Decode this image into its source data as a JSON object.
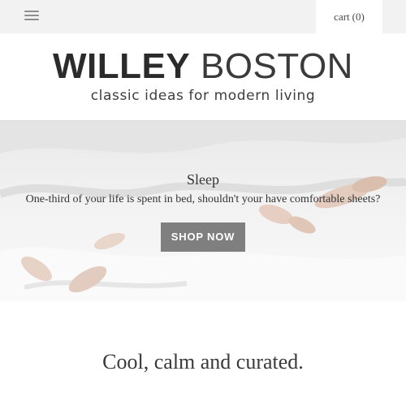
{
  "header": {
    "menu_icon": "hamburger-icon",
    "cart_label": "cart",
    "cart_count": "(0)"
  },
  "logo": {
    "title_bold": "WILLEY",
    "title_light": "BOSTON",
    "tagline": "classic ideas for modern living"
  },
  "hero": {
    "title": "Sleep",
    "subtitle": "One-third of your life is spent in bed, shouldn't your have comfortable sheets?",
    "button_label": "SHOP NOW"
  },
  "section": {
    "heading": "Cool, calm and curated."
  },
  "colors": {
    "topbar_bg": "#f2f2f2",
    "button_bg": "#7f7f7f",
    "text": "#333333"
  }
}
